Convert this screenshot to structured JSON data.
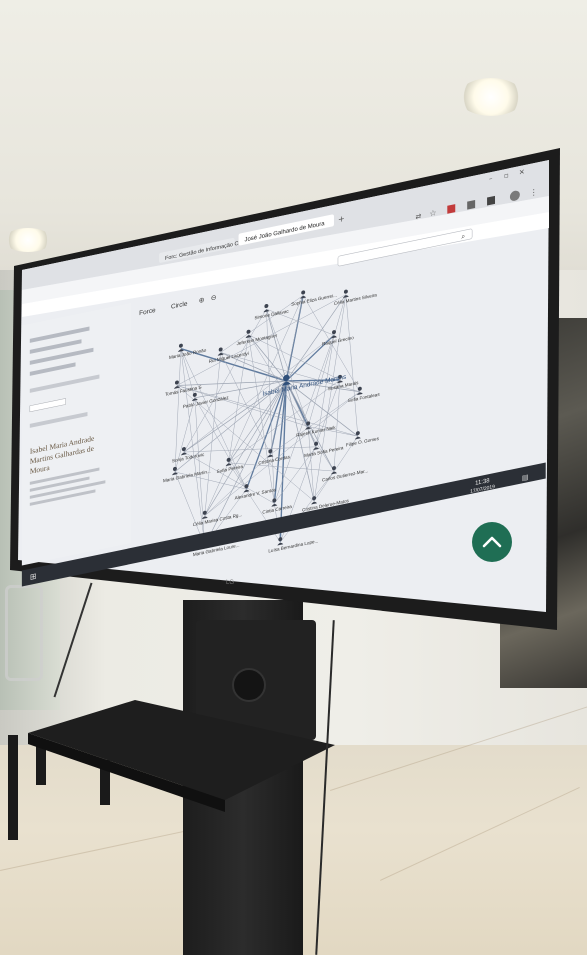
{
  "browser": {
    "tabs": [
      {
        "label": "Forc: Gestão de Informação Cie"
      },
      {
        "label": "José João Galhardo de Moura"
      }
    ],
    "search_placeholder": ""
  },
  "graph_toolbar": {
    "force_label": "Force",
    "circle_label": "Circle"
  },
  "sidebar": {
    "name_lines": [
      "Isabel Maria Andrade",
      "Martins Galhardas de",
      "Moura"
    ]
  },
  "graph": {
    "center_name": "Isabel Maria Andrade Martins",
    "nodes": [
      {
        "label": "Sophia Eliza Guerrei..."
      },
      {
        "label": "Simone Dallavac"
      },
      {
        "label": "Célia Martins Silveira"
      },
      {
        "label": "Maria João Ronão"
      },
      {
        "label": "Jeferson Montagner"
      },
      {
        "label": "Rui Miguel Lacerdyi"
      },
      {
        "label": "Raquel Greclno"
      },
      {
        "label": "Tomás Faustina S"
      },
      {
        "label": "Pablo Javier González"
      },
      {
        "label": "Susana Marais"
      },
      {
        "label": "Sofia Fontaleas"
      },
      {
        "label": "Sonja Todorovic"
      },
      {
        "label": "Rajesh Kumar Naik"
      },
      {
        "label": "Maria Gabriela Martin..."
      },
      {
        "label": "Sofia Pereira"
      },
      {
        "label": "Cristina Cordas"
      },
      {
        "label": "Marta Sofia Pereira"
      },
      {
        "label": "Filipe O. Gomes"
      },
      {
        "label": "Alexandre V. Santos"
      },
      {
        "label": "Carlos Gutierrez-Mar..."
      },
      {
        "label": "Célia Marisa Costa Rg..."
      },
      {
        "label": "Cintia Carreira"
      },
      {
        "label": "Cristina Delerue-Matos"
      },
      {
        "label": "Maria Gabriela Loure..."
      },
      {
        "label": "Luísa Bernardina Lope..."
      }
    ]
  },
  "taskbar": {
    "time": "11:38",
    "date": "17/07/2019"
  },
  "brand_text": "LG",
  "colors": {
    "accent_green": "#1f6e54",
    "screen_bg": "#eceef2",
    "edge_blue": "#3e5f8a"
  }
}
